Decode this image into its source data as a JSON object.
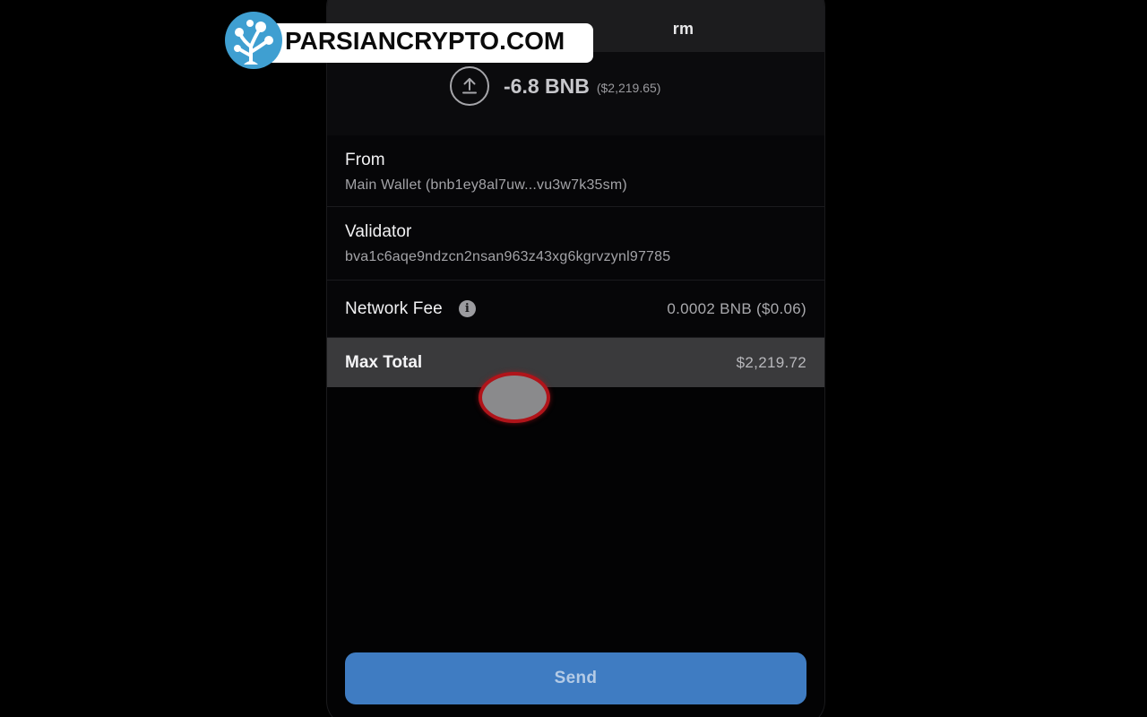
{
  "watermark": {
    "text": "PARSIANCRYPTO.COM",
    "logo_icon": "tree-network-logo-icon",
    "colors": {
      "logo_blue": "#3f9fd1",
      "pill": "#ffffff"
    }
  },
  "header": {
    "title_fragment": "rm"
  },
  "amount": {
    "icon": "upload-arrow-icon",
    "value": "-6.8 BNB",
    "fiat": "($2,219.65)"
  },
  "details": {
    "from": {
      "label": "From",
      "value": "Main Wallet (bnb1ey8al7uw...vu3w7k35sm)"
    },
    "validator": {
      "label": "Validator",
      "value": "bva1c6aqe9ndzcn2nsan963z43xg6kgrvzynl97785"
    },
    "network_fee": {
      "label": "Network Fee",
      "info_icon": "info-icon",
      "info_glyph": "i",
      "value": "0.0002 BNB ($0.06)"
    },
    "max_total": {
      "label": "Max Total",
      "value": "$2,219.72"
    }
  },
  "actions": {
    "send_label": "Send"
  },
  "colors": {
    "background": "#000000",
    "screen": "#030304",
    "total_row": "#3a3a3c",
    "send_button": "#3f7cc2",
    "touch_ring": "#b0141a"
  }
}
